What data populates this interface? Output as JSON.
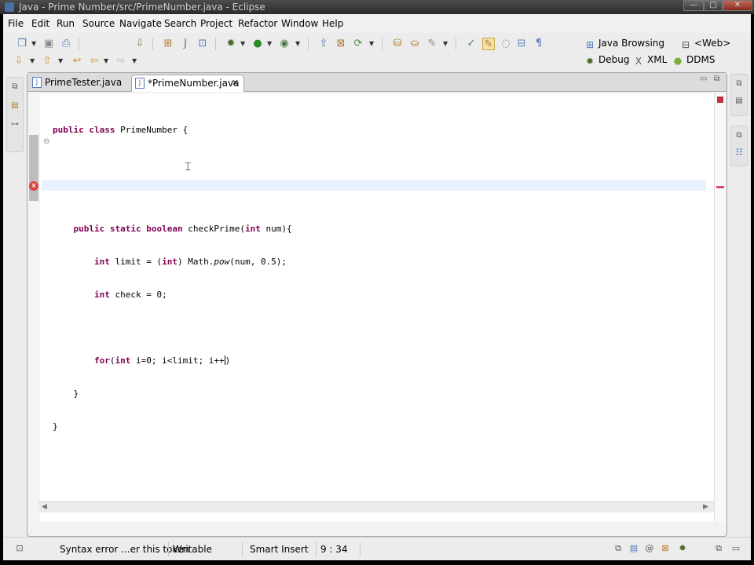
{
  "window": {
    "title": "Java - Prime Number/src/PrimeNumber.java - Eclipse",
    "minimize": "—",
    "maximize": "□",
    "close": "✕"
  },
  "menu": [
    "File",
    "Edit",
    "Run",
    "Source",
    "Navigate",
    "Search",
    "Project",
    "Refactor",
    "Window",
    "Help"
  ],
  "perspectives": {
    "java_browsing": "Java Browsing",
    "web": "<Web>",
    "debug": "Debug",
    "xml": "XML",
    "ddms": "DDMS"
  },
  "tabs": [
    {
      "label": "PrimeTester.java",
      "active": false
    },
    {
      "label": "*PrimeNumber.java",
      "active": true,
      "close": "✕"
    }
  ],
  "code": {
    "l1_kw": "public class",
    "l1_rest": " PrimeNumber {",
    "l4_kw": "public static boolean",
    "l4_rest": " checkPrime(",
    "l4_kw2": "int",
    "l4_rest2": " num){",
    "l5_kw": "int",
    "l5_a": " limit = (",
    "l5_kw2": "int",
    "l5_b": ") Math.",
    "l5_it": "pow",
    "l5_c": "(num, 0.5);",
    "l6_kw": "int",
    "l6_rest": " check = 0;",
    "l8_kw": "for",
    "l8_a": "(",
    "l8_kw2": "int",
    "l8_b": " i=0; i<limit; i++",
    "l8_c": ")",
    "l9": "}",
    "l10": "}"
  },
  "status": {
    "message": "Syntax error ...er this token",
    "mode": "Writable",
    "insert": "Smart Insert",
    "position": "9 : 34"
  },
  "colors": {
    "keyword": "#7f0055",
    "current_line": "#e8f2fe",
    "error": "#d8453a"
  }
}
